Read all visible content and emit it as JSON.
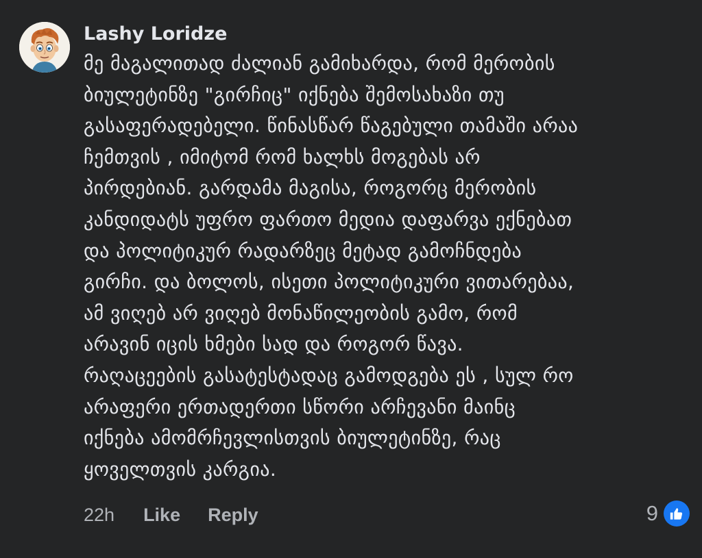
{
  "comment": {
    "author": "Lashy Loridze",
    "lines": [
      "მე მაგალითად ძალიან გამიხარდა, რომ მერობის",
      "ბიულეტინზე \"გირჩიც\" იქნება შემოსახაზი თუ",
      "გასაფერადებელი. წინასწარ წაგებული თამაში არაა",
      "ჩემთვის , იმიტომ რომ ხალხს მოგებას არ",
      "პირდებიან. გარდამა მაგისა, როგორც მერობის",
      "კანდიდატს უფრო ფართო მედია დაფარვა ექნებათ",
      "და პოლიტიკურ რადარზეც მეტად გამოჩნდება",
      "გირჩი. და ბოლოს, ისეთი პოლიტიკური ვითარებაა,",
      "ამ ვიღებ არ ვიღებ მონაწილეობის გამო, რომ",
      "არავინ იცის ხმები სად და როგორ წავა.",
      "რაღაცეების გასატესტადაც გამოდგება ეს , სულ რო",
      "არაფერი ერთადერთი სწორი არჩევანი მაინც",
      "იქნება ამომრჩევლისთვის ბიულეტინზე, რაც",
      "ყოველთვის კარგია."
    ],
    "time": "22h",
    "like_label": "Like",
    "reply_label": "Reply",
    "reaction_count": "9",
    "reaction_icon": "thumbs-up-icon",
    "colors": {
      "background": "#242526",
      "text": "#e4e6eb",
      "secondary_text": "#b0b3b8",
      "like_badge": "#1877f2"
    }
  }
}
